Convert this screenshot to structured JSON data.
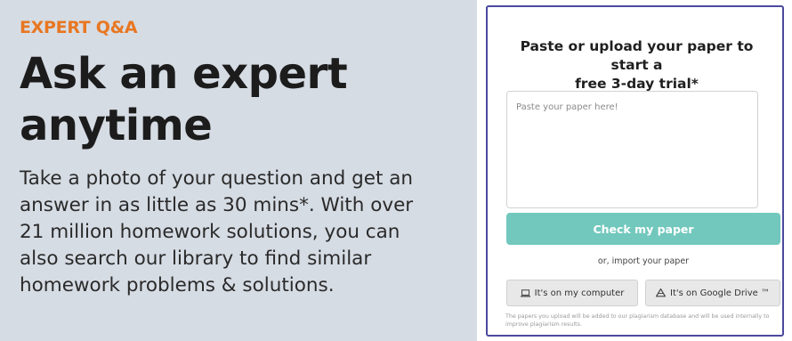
{
  "promo": {
    "eyebrow": "EXPERT Q&A",
    "headline_line1": "Ask an expert",
    "headline_line2": "anytime",
    "body_lines": [
      "Take a photo of your question and get an",
      "answer in as little as 30 mins*. With over",
      "21 million homework solutions, you can",
      "also search our library to find similar",
      "homework problems & solutions."
    ]
  },
  "trial_panel": {
    "title_line1": "Paste or upload your paper to start a",
    "title_line2": "free 3-day trial*",
    "paper_input_placeholder": "Paste your paper here!",
    "check_button_label": "Check my paper",
    "or_import_text": "or, import your paper",
    "computer_button_label": "It's on my computer",
    "drive_button_label": "It's on Google Drive ™",
    "disclaimer": "The papers you upload will be added to our plagiarism database and will be used internally to improve plagiarism results."
  },
  "icons": {
    "computer": "laptop-icon",
    "drive": "google-drive-icon"
  },
  "colors": {
    "eyebrow": "#e87722",
    "promo_background": "#d6dce4",
    "panel_border": "#4b4a9e",
    "check_button": "#72c8bd",
    "source_button": "#e8e8e8"
  }
}
